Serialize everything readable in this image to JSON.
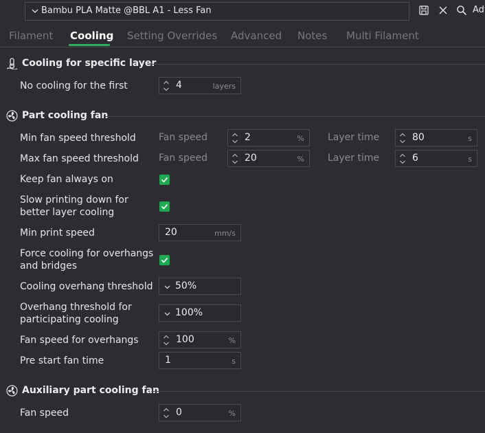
{
  "topbar": {
    "preset_value": "Bambu PLA Matte @BBL A1 - Less Fan",
    "adv_label": "Adv",
    "icons": [
      "chevron-down-icon",
      "save-icon",
      "close-icon",
      "search-icon"
    ]
  },
  "tabs": [
    {
      "label": "Filament"
    },
    {
      "label": "Cooling",
      "active": true
    },
    {
      "label": "Setting Overrides"
    },
    {
      "label": "Advanced"
    },
    {
      "label": "Notes"
    },
    {
      "label": "Multi Filament"
    }
  ],
  "accent_color": "#2fae61",
  "sections": {
    "specific_layer": {
      "title": "Cooling for specific layer",
      "no_cooling": {
        "label": "No cooling for the first",
        "value": "4",
        "unit": "layers"
      }
    },
    "part_fan": {
      "title": "Part cooling fan",
      "min_threshold": {
        "label": "Min fan speed threshold",
        "fan_label": "Fan speed",
        "fan_value": "2",
        "fan_unit": "%",
        "time_label": "Layer time",
        "time_value": "80",
        "time_unit": "s"
      },
      "max_threshold": {
        "label": "Max fan speed threshold",
        "fan_label": "Fan speed",
        "fan_value": "20",
        "fan_unit": "%",
        "time_label": "Layer time",
        "time_value": "6",
        "time_unit": "s"
      },
      "keep_fan": {
        "label": "Keep fan always on",
        "checked": true
      },
      "slow_down": {
        "label_line1": "Slow printing down for",
        "label_line2": "better layer cooling",
        "checked": true
      },
      "min_print_speed": {
        "label": "Min print speed",
        "value": "20",
        "unit": "mm/s"
      },
      "force_cooling": {
        "label_line1": "Force cooling for overhangs",
        "label_line2": "and bridges",
        "checked": true
      },
      "overhang_threshold": {
        "label": "Cooling overhang threshold",
        "value": "50%"
      },
      "participating": {
        "label_line1": "Overhang threshold for",
        "label_line2": "participating cooling",
        "value": "100%"
      },
      "overhang_fan": {
        "label": "Fan speed for overhangs",
        "value": "100",
        "unit": "%"
      },
      "pre_start": {
        "label": "Pre start fan time",
        "value": "1",
        "unit": "s"
      }
    },
    "aux_fan": {
      "title": "Auxiliary part cooling fan",
      "fan_speed": {
        "label": "Fan speed",
        "value": "0",
        "unit": "%"
      }
    }
  }
}
